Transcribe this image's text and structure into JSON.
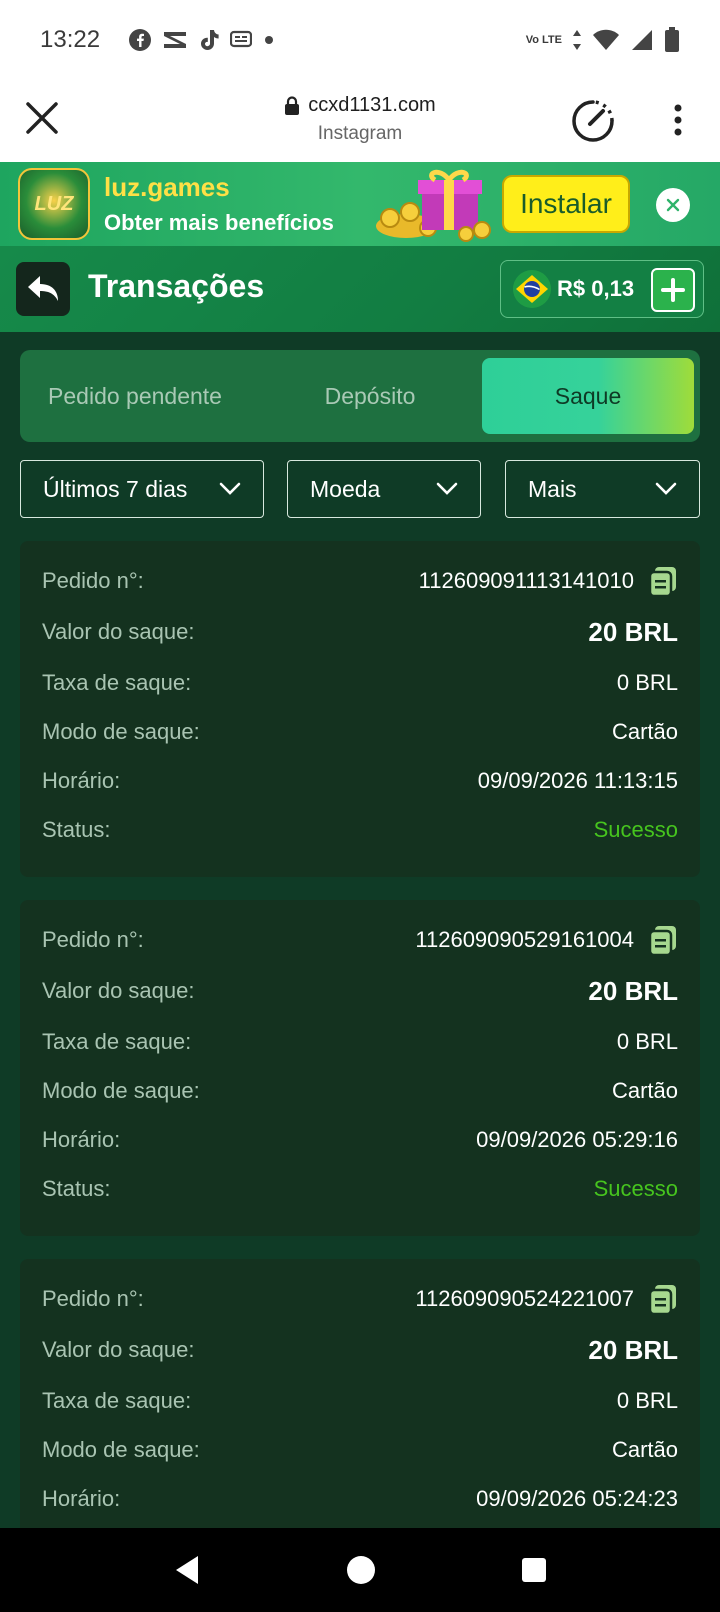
{
  "status_bar": {
    "time": "13:22",
    "network_label": "Vo LTE",
    "icons": [
      "facebook-icon",
      "capcut-icon",
      "tiktok-icon",
      "message-icon",
      "dot-icon",
      "wifi-icon",
      "signal-icon",
      "battery-icon"
    ]
  },
  "browser": {
    "url": "ccxd1131.com",
    "source": "Instagram"
  },
  "banner": {
    "title": "luz.games",
    "subtitle": "Obter mais benefícios",
    "install_label": "Instalar",
    "logo_text": "LUZ"
  },
  "header": {
    "title": "Transações",
    "balance": "R$ 0,13"
  },
  "tabs": [
    {
      "label": "Pedido pendente",
      "active": false
    },
    {
      "label": "Depósito",
      "active": false
    },
    {
      "label": "Saque",
      "active": true
    }
  ],
  "filters": [
    {
      "label": "Últimos 7 dias"
    },
    {
      "label": "Moeda"
    },
    {
      "label": "Mais"
    }
  ],
  "labels": {
    "order": "Pedido n°:",
    "amount": "Valor do saque:",
    "fee": "Taxa de saque:",
    "mode": "Modo de saque:",
    "time": "Horário:",
    "status": "Status:"
  },
  "transactions": [
    {
      "order": "112609091113141010",
      "amount": "20 BRL",
      "fee": "0 BRL",
      "mode": "Cartão",
      "time": "09/09/2026 11:13:15",
      "status": "Sucesso"
    },
    {
      "order": "112609090529161004",
      "amount": "20 BRL",
      "fee": "0 BRL",
      "mode": "Cartão",
      "time": "09/09/2026 05:29:16",
      "status": "Sucesso"
    },
    {
      "order": "112609090524221007",
      "amount": "20 BRL",
      "fee": "0 BRL",
      "mode": "Cartão",
      "time": "09/09/2026 05:24:23",
      "status": ""
    }
  ],
  "colors": {
    "accent": "#2ecf98",
    "success": "#46c41e",
    "background": "#0f3b26",
    "card": "#14321f",
    "banner_title": "#ffe046"
  }
}
